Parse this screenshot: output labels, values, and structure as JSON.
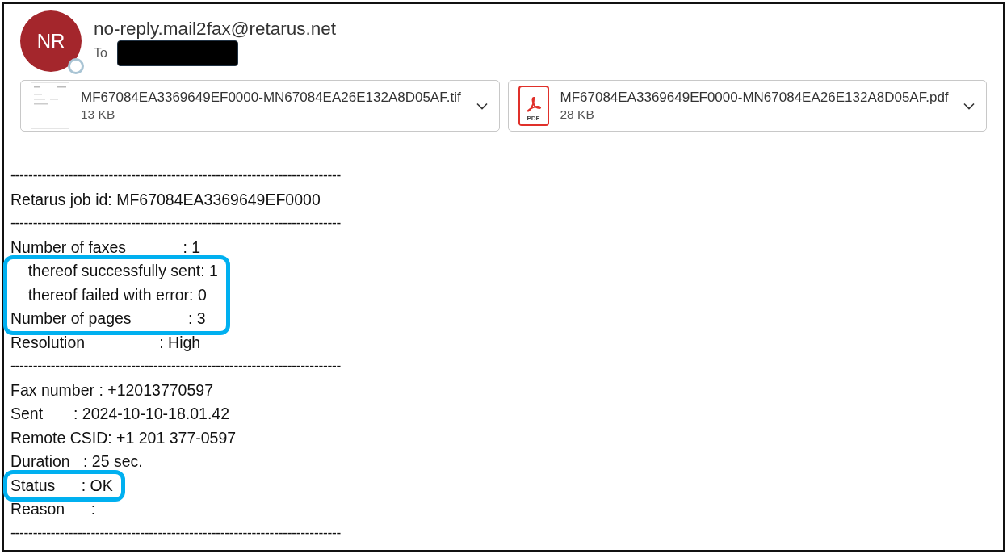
{
  "sender": {
    "initials": "NR",
    "address": "no-reply.mail2fax@retarus.net",
    "to_label": "To"
  },
  "attachments": [
    {
      "kind": "image",
      "name": "MF67084EA3369649EF0000-MN67084EA26E132A8D05AF.tif",
      "size": "13 KB"
    },
    {
      "kind": "pdf",
      "icon_text": "PDF",
      "name": "MF67084EA3369649EF0000-MN67084EA26E132A8D05AF.pdf",
      "size": "28 KB"
    }
  ],
  "body": [
    {
      "kind": "rule",
      "text": "--------------------------------------------------------------------------"
    },
    {
      "kind": "line",
      "text": "Retarus job id: MF67084EA3369649EF0000"
    },
    {
      "kind": "rule",
      "text": "--------------------------------------------------------------------------"
    },
    {
      "kind": "line",
      "text": "Number of faxes             : 1"
    },
    {
      "kind": "highlight",
      "lines": [
        "    thereof successfully sent: 1",
        "    thereof failed with error: 0",
        "Number of pages             : 3"
      ]
    },
    {
      "kind": "line",
      "text": "Resolution                 : High"
    },
    {
      "kind": "rule",
      "text": "--------------------------------------------------------------------------"
    },
    {
      "kind": "line",
      "text": "Fax number : +12013770597"
    },
    {
      "kind": "line",
      "text": "Sent       : 2024-10-10-18.01.42"
    },
    {
      "kind": "line",
      "text": "Remote CSID: +1 201 377-0597"
    },
    {
      "kind": "line",
      "text": "Duration   : 25 sec."
    },
    {
      "kind": "highlight",
      "lines": [
        "Status      : OK"
      ]
    },
    {
      "kind": "line",
      "text": "Reason      :"
    },
    {
      "kind": "rule",
      "text": "--------------------------------------------------------------------------"
    }
  ]
}
